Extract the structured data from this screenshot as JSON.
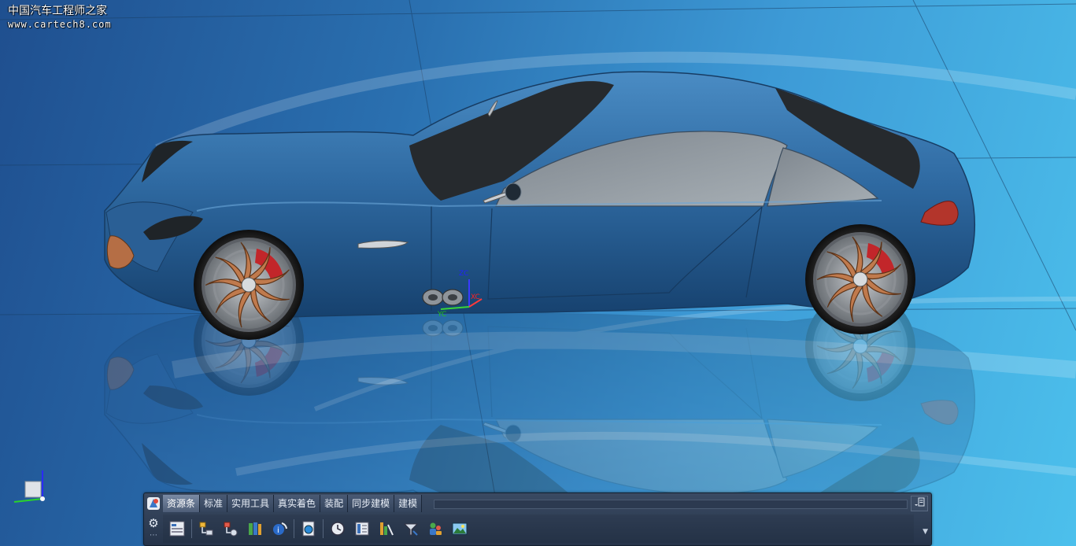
{
  "watermark": {
    "line1": "中国汽车工程师之家",
    "line2": "www.cartech8.com"
  },
  "viewport": {
    "background_from": "#1f4f8f",
    "background_to": "#4cc0ec",
    "car_body_color": "#2f6aa2",
    "window_color": "#8e969e",
    "rim_color": "#c07a4d",
    "caliper_color": "#c2262a"
  },
  "axis_labels": {
    "z": "ZC",
    "x": "XC",
    "y": "YC"
  },
  "resource_bar": {
    "tabs": [
      {
        "label": "资源条",
        "active": true
      },
      {
        "label": "标准",
        "active": false
      },
      {
        "label": "实用工具",
        "active": false
      },
      {
        "label": "真实着色",
        "active": false
      },
      {
        "label": "装配",
        "active": false
      },
      {
        "label": "同步建模",
        "active": false
      },
      {
        "label": "建模",
        "active": false
      }
    ],
    "tools": [
      "assembly-navigator-icon",
      "constraint-navigator-icon",
      "part-navigator-icon",
      "reuse-library-icon",
      "hd3d-tools-icon",
      "web-browser-icon",
      "history-icon",
      "process-studio-icon",
      "manufacturing-wizard-icon",
      "roles-icon",
      "system-scenes-icon"
    ]
  }
}
